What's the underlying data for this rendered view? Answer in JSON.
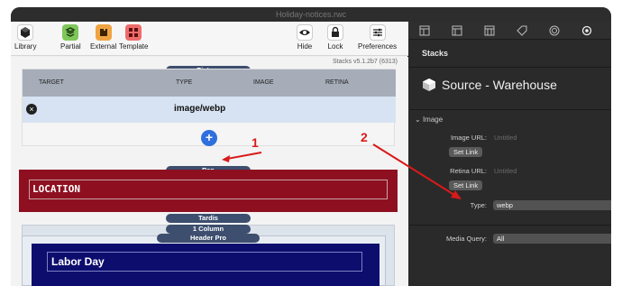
{
  "window": {
    "title": "Holiday-notices.rwc"
  },
  "toolbar": {
    "library": "Library",
    "partial": "Partial",
    "external": "External",
    "template": "Template",
    "hide": "Hide",
    "lock": "Lock",
    "preferences": "Preferences"
  },
  "canvas": {
    "version": "Stacks v5.1.2b7 (6313)",
    "picture_label": "Picture",
    "columns": [
      "TARGET",
      "TYPE",
      "IMAGE",
      "RETINA"
    ],
    "row": {
      "type": "image/webp"
    },
    "add_label": "+",
    "pen_label": "Pen",
    "location_text": "LOCATION",
    "tardis_label": "Tardis",
    "one_column_label": "1 Column",
    "header_pro_label": "Header Pro",
    "labor_day_text": "Labor Day"
  },
  "annotations": {
    "one": "1",
    "two": "2",
    "color": "#d91a1a"
  },
  "inspector": {
    "panel_title": "Stacks",
    "source_title": "Source - Warehouse",
    "section": "Image",
    "image_url_label": "Image URL:",
    "image_url_placeholder": "Untitled",
    "set_link": "Set Link",
    "retina_url_label": "Retina URL:",
    "retina_url_placeholder": "Untitled",
    "type_label": "Type:",
    "type_value": "webp",
    "media_query_label": "Media Query:",
    "media_query_value": "All"
  },
  "icons": [
    "library-icon",
    "partial-icon",
    "external-icon",
    "template-icon",
    "eye-icon",
    "lock-icon",
    "sliders-icon",
    "cube-icon"
  ],
  "colors": {
    "accent_blue": "#2f6fde",
    "pen_red": "#8e1020",
    "header_navy": "#0d0d6e",
    "table_head": "#a6adb8",
    "table_row": "#d7e3f2"
  }
}
